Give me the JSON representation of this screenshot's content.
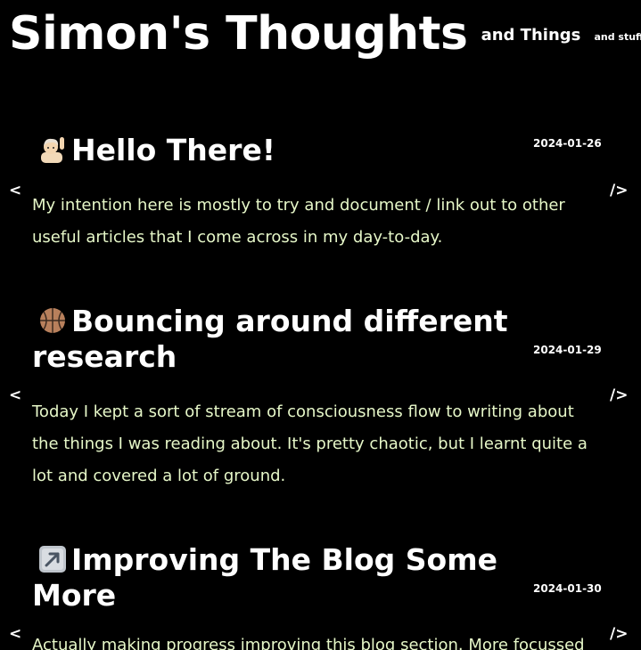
{
  "header": {
    "site_title": "Simon's Thoughts",
    "tagline": "and Things",
    "subtagline": "and stuff..."
  },
  "posts": [
    {
      "emoji": "raising-hand-icon",
      "title": "Hello There!",
      "date": "2024-01-26",
      "excerpt": "My intention here is mostly to try and document / link out to other useful articles that I come across in my day-to-day.",
      "bracket_open": "<",
      "bracket_close": "/>"
    },
    {
      "emoji": "basketball-icon",
      "title": "Bouncing around different research",
      "date": "2024-01-29",
      "excerpt": "Today I kept a sort of stream of consciousness flow to writing about the things I was reading about. It's pretty chaotic, but I learnt quite a lot and covered a lot of ground.",
      "bracket_open": "<",
      "bracket_close": "/>"
    },
    {
      "emoji": "arrow-up-right-icon",
      "title": "Improving The Blog Some More",
      "date": "2024-01-30",
      "excerpt": "Actually making progress improving this blog section. More focussed",
      "bracket_open": "<",
      "bracket_close": "/>"
    }
  ],
  "colors": {
    "background": "#000000",
    "text": "#ffffff",
    "excerpt": "#e6f7c8"
  }
}
